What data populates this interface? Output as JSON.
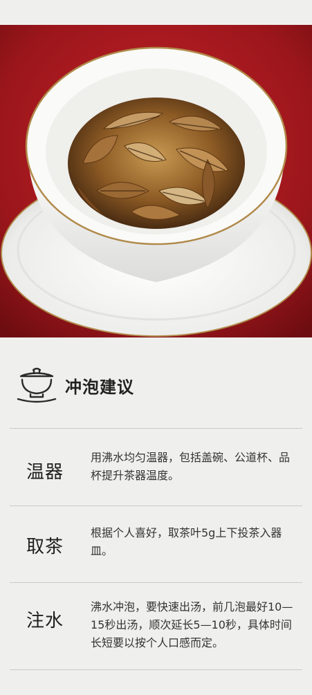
{
  "section": {
    "title": "冲泡建议",
    "icon": "gaiwan-icon"
  },
  "steps": [
    {
      "name": "温器",
      "desc": "用沸水均匀温器，包括盖碗、公道杯、品杯提升茶器温度。"
    },
    {
      "name": "取茶",
      "desc": "根据个人喜好，取茶叶5g上下投茶入器皿。"
    },
    {
      "name": "注水",
      "desc": "沸水冲泡，要快速出汤，前几泡最好10—15秒出汤，顺次延长5—10秒，具体时间长短要以按个人口感而定。"
    }
  ],
  "colors": {
    "background": "#efefed",
    "backdrop_red": "#a3181c",
    "porcelain": "#f4f4f2",
    "gold_rim": "#b08a4a",
    "tea_leaf": "#8a5a2c"
  }
}
